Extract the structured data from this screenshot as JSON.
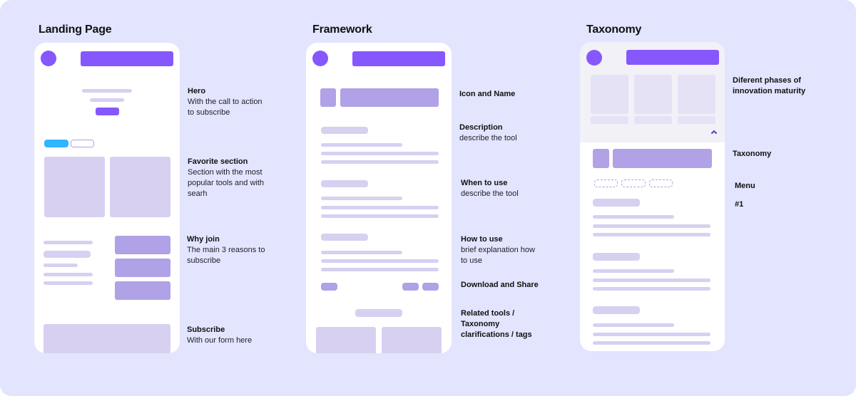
{
  "columns": [
    {
      "title": "Landing Page",
      "notes": [
        {
          "title": "Hero",
          "desc_lines": [
            "With the call to action",
            "to subscribe"
          ]
        },
        {
          "title": "Favorite section",
          "desc_lines": [
            "Section with the most",
            "popular tools and with",
            "searh"
          ]
        },
        {
          "title": "Why join",
          "desc_lines": [
            "The main 3 reasons to",
            "subscribe"
          ]
        },
        {
          "title": "Subscribe",
          "desc_lines": [
            "With our form here"
          ]
        }
      ]
    },
    {
      "title": "Framework",
      "notes": [
        {
          "title": "Icon and Name",
          "desc_lines": []
        },
        {
          "title": "Description",
          "desc_lines": [
            "describe the tool"
          ]
        },
        {
          "title": "When to use",
          "desc_lines": [
            "describe the tool"
          ]
        },
        {
          "title": "How to use",
          "desc_lines": [
            "brief explanation how",
            "to use"
          ]
        },
        {
          "title": "Download and Share",
          "desc_lines": []
        },
        {
          "title": "Related tools /",
          "desc_lines": [
            "Taxonomy",
            "clarifications / tags"
          ],
          "all_bold": true
        }
      ]
    },
    {
      "title": "Taxonomy",
      "notes": [
        {
          "title": "Diferent phases of",
          "desc_lines": [
            "innovation maturity"
          ],
          "all_bold": true
        },
        {
          "title": "Taxonomy",
          "desc_lines": []
        },
        {
          "title": "Menu",
          "desc_lines": []
        },
        {
          "title": "#1",
          "desc_lines": []
        }
      ],
      "collapse_icon": "chevron-up-icon"
    }
  ],
  "colors": {
    "background": "#e2e5fd",
    "accent": "#8657fd",
    "block_mid": "#b1a1e6",
    "block_light": "#d7d0f1",
    "highlight_tab": "#30b5ff"
  }
}
